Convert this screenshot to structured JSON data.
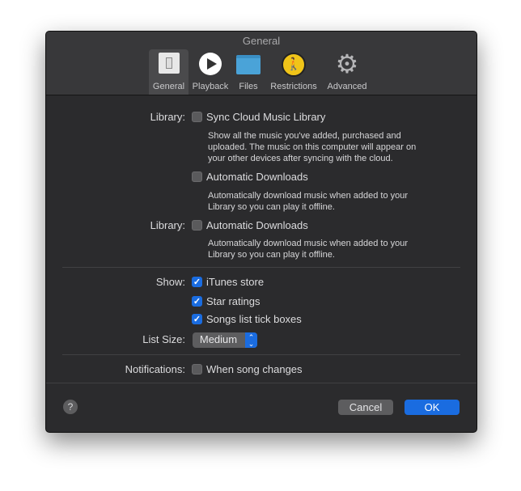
{
  "window": {
    "title": "General"
  },
  "toolbar": [
    {
      "label": "General",
      "icon": "switch-icon",
      "selected": true
    },
    {
      "label": "Playback",
      "icon": "play-icon"
    },
    {
      "label": "Files",
      "icon": "folder-icon"
    },
    {
      "label": "Restrictions",
      "icon": "parental-icon"
    },
    {
      "label": "Advanced",
      "icon": "gear-icon"
    }
  ],
  "library1": {
    "label": "Library:",
    "option": "Sync Cloud Music Library",
    "checked": false,
    "desc": [
      "Show all the music you've added, purchased and",
      "uploaded. The music on this computer will appear on",
      "your other devices after syncing with the cloud."
    ]
  },
  "auto1": {
    "option": "Automatic Downloads",
    "checked": false,
    "desc": [
      "Automatically download music when added to your",
      "Library so you can play it offline."
    ]
  },
  "library2": {
    "label": "Library:",
    "option": "Automatic Downloads",
    "checked": false,
    "desc": [
      "Automatically download music when added to your",
      "Library so you can play it offline."
    ]
  },
  "show": {
    "label": "Show:",
    "options": [
      {
        "label": "iTunes store",
        "checked": true
      },
      {
        "label": "Star ratings",
        "checked": true
      },
      {
        "label": "Songs list tick boxes",
        "checked": true
      }
    ]
  },
  "list_size": {
    "label": "List Size:",
    "value": "Medium"
  },
  "notifications": {
    "label": "Notifications:",
    "option": "When song changes",
    "checked": false
  },
  "footer": {
    "help": "?",
    "cancel": "Cancel",
    "ok": "OK"
  },
  "colors": {
    "accent": "#1a6ce0"
  }
}
